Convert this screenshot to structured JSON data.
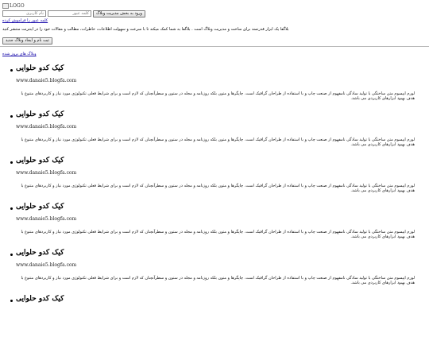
{
  "header": {
    "logo_alt": "LOGO",
    "login": {
      "username_placeholder": "نام کاربری",
      "password_placeholder": "کلمه عبور",
      "login_button": "ورود به بخش مدیریت وبلاگ"
    },
    "forgot_link": "کلمه عبور را فراموش کرده"
  },
  "intro_text": "بلاگفا یک ابزار قدرتمند برای ساخت و مدیریت وبلاگ است . بلاگفا به شما کمک میکند تا با سرعت و سهولت اطلاعات، خاطرات، مطالب و مقالات خود را در اینترنت منتشر کنید",
  "create_button": "ثبت نام و ایجاد وبلاگ جدید",
  "updated_link": "وبلاگ های بروز شده",
  "blogs": [
    {
      "title": "کیک کدو حلوایی",
      "url": "www.danaie5.blogfa.com",
      "desc": "لورم ایپسوم متن ساختگی با تولید سادگی نامفهوم از صنعت چاپ و با استفاده از طراحان گرافیک است. چاپگرها و متون بلکه روزنامه و مجله در ستون و سطرآنچنان که لازم است و برای شرایط فعلی تکنولوژی مورد نیاز و کاربردهای متنوع با هدف بهبود ابزارهای کاربردی می باشد."
    },
    {
      "title": "کیک کدو حلوایی",
      "url": "www.danaie5.blogfa.com",
      "desc": "لورم ایپسوم متن ساختگی با تولید سادگی نامفهوم از صنعت چاپ و با استفاده از طراحان گرافیک است. چاپگرها و متون بلکه روزنامه و مجله در ستون و سطرآنچنان که لازم است و برای شرایط فعلی تکنولوژی مورد نیاز و کاربردهای متنوع با هدف بهبود ابزارهای کاربردی می باشد."
    },
    {
      "title": "کیک کدو حلوایی",
      "url": "www.danaie5.blogfa.com",
      "desc": "لورم ایپسوم متن ساختگی با تولید سادگی نامفهوم از صنعت چاپ و با استفاده از طراحان گرافیک است. چاپگرها و متون بلکه روزنامه و مجله در ستون و سطرآنچنان که لازم است و برای شرایط فعلی تکنولوژی مورد نیاز و کاربردهای متنوع با هدف بهبود ابزارهای کاربردی می باشد."
    },
    {
      "title": "کیک کدو حلوایی",
      "url": "www.danaie5.blogfa.com",
      "desc": "لورم ایپسوم متن ساختگی با تولید سادگی نامفهوم از صنعت چاپ و با استفاده از طراحان گرافیک است. چاپگرها و متون بلکه روزنامه و مجله در ستون و سطرآنچنان که لازم است و برای شرایط فعلی تکنولوژی مورد نیاز و کاربردهای متنوع با هدف بهبود ابزارهای کاربردی می باشد."
    },
    {
      "title": "کیک کدو حلوایی",
      "url": "www.danaie5.blogfa.com",
      "desc": "لورم ایپسوم متن ساختگی با تولید سادگی نامفهوم از صنعت چاپ و با استفاده از طراحان گرافیک است. چاپگرها و متون بلکه روزنامه و مجله در ستون و سطرآنچنان که لازم است و برای شرایط فعلی تکنولوژی مورد نیاز و کاربردهای متنوع با هدف بهبود ابزارهای کاربردی می باشد."
    },
    {
      "title": "کیک کدو حلوایی",
      "url": "",
      "desc": ""
    }
  ]
}
